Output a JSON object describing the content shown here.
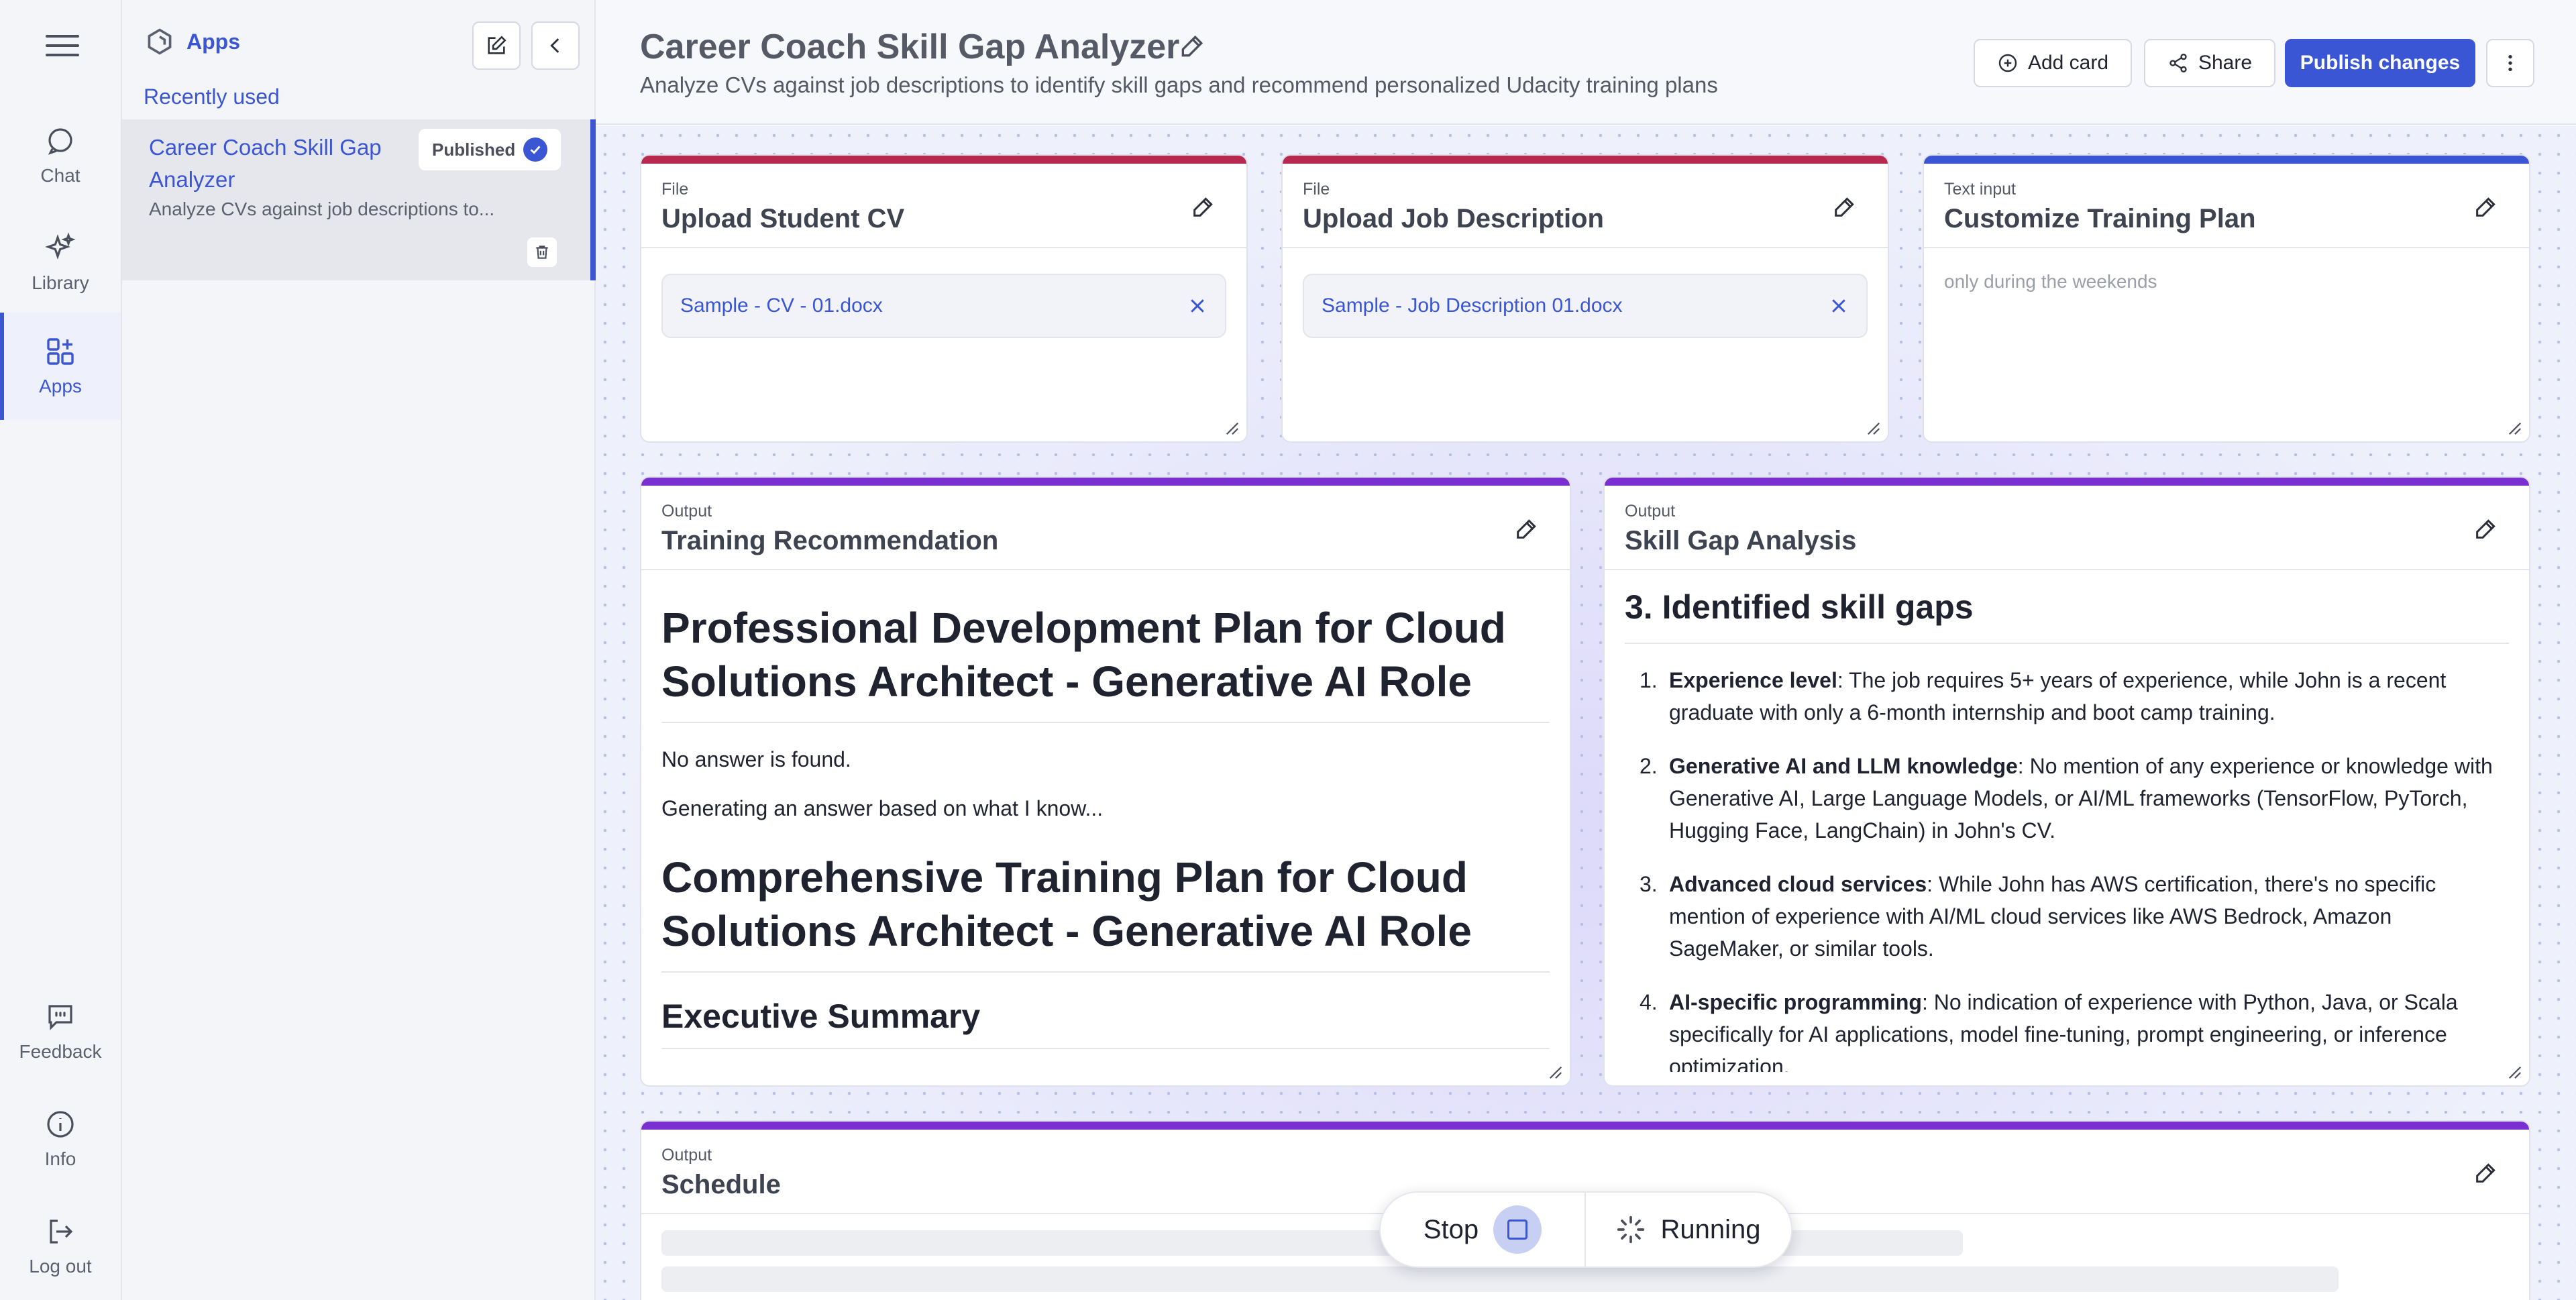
{
  "rail": {
    "items": [
      {
        "label": "Chat",
        "icon": "chat-icon"
      },
      {
        "label": "Library",
        "icon": "sparkle-icon"
      },
      {
        "label": "Apps",
        "icon": "apps-grid-icon"
      },
      {
        "label": "Feedback",
        "icon": "feedback-icon"
      },
      {
        "label": "Info",
        "icon": "info-icon"
      },
      {
        "label": "Log out",
        "icon": "logout-icon"
      }
    ]
  },
  "panel": {
    "title": "Apps",
    "recently_used": "Recently used",
    "app": {
      "name": "Career Coach Skill Gap Analyzer",
      "description": "Analyze CVs against job descriptions to...",
      "badge": "Published"
    }
  },
  "header": {
    "title": "Career Coach Skill Gap Analyzer",
    "subtitle": "Analyze CVs against job descriptions to identify skill gaps and recommend personalized Udacity training plans",
    "add_card": "Add card",
    "share": "Share",
    "publish": "Publish changes"
  },
  "cards": {
    "cv": {
      "label": "File",
      "title": "Upload Student CV",
      "file": "Sample - CV - 01.docx"
    },
    "jd": {
      "label": "File",
      "title": "Upload Job Description",
      "file": "Sample - Job Description 01.docx"
    },
    "custom": {
      "label": "Text input",
      "title": "Customize Training Plan",
      "value": "only during the weekends"
    },
    "training": {
      "label": "Output",
      "title": "Training Recommendation",
      "h1a": "Professional Development Plan for Cloud Solutions Architect - Generative AI Role",
      "p1": "No answer is found.",
      "p2": "Generating an answer based on what I know...",
      "h1b": "Comprehensive Training Plan for Cloud Solutions Architect - Generative AI Role",
      "h2": "Executive Summary"
    },
    "gap": {
      "label": "Output",
      "title": "Skill Gap Analysis",
      "heading": "3. Identified skill gaps",
      "items": [
        {
          "num": "1.",
          "bold": "Experience level",
          "text": ": The job requires 5+ years of experience, while John is a recent graduate with only a 6-month internship and boot camp training."
        },
        {
          "num": "2.",
          "bold": "Generative AI and LLM knowledge",
          "text": ": No mention of any experience or knowledge with Generative AI, Large Language Models, or AI/ML frameworks (TensorFlow, PyTorch, Hugging Face, LangChain) in John's CV."
        },
        {
          "num": "3.",
          "bold": "Advanced cloud services",
          "text": ": While John has AWS certification, there's no specific mention of experience with AI/ML cloud services like AWS Bedrock, Amazon SageMaker, or similar tools."
        },
        {
          "num": "4.",
          "bold": "AI-specific programming",
          "text": ": No indication of experience with Python, Java, or Scala specifically for AI applications, model fine-tuning, prompt engineering, or inference optimization."
        }
      ]
    },
    "schedule": {
      "label": "Output",
      "title": "Schedule"
    }
  },
  "runbar": {
    "stop": "Stop",
    "running": "Running"
  },
  "colors": {
    "accent": "#3a56d4",
    "file_card": "#b8294f",
    "text_card": "#3a56d4",
    "output_card": "#7a2fd0"
  }
}
